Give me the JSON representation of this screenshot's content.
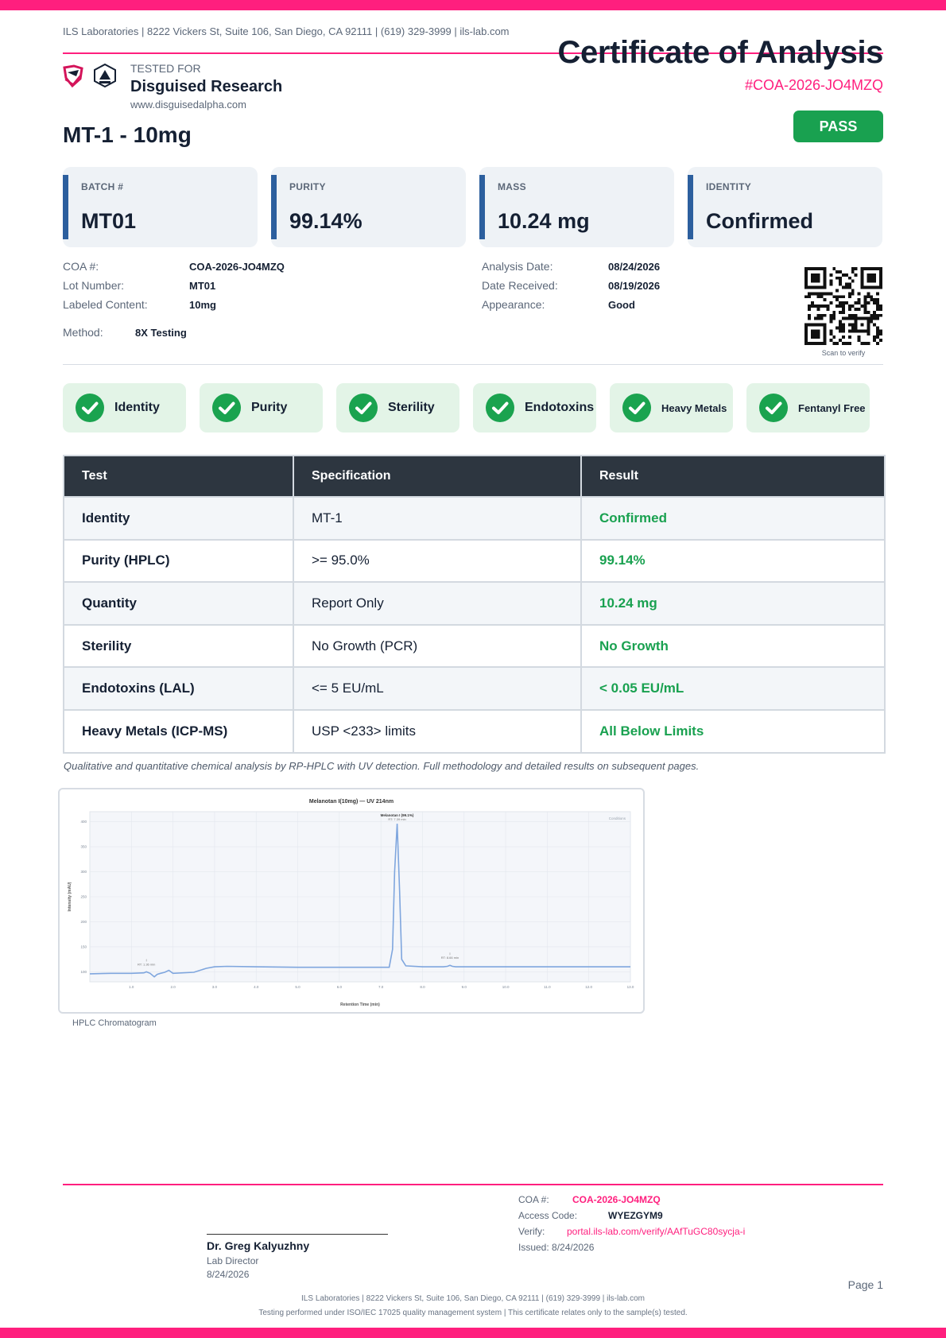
{
  "header": {
    "lab_line": "ILS Laboratories  |  8222 Vickers St, Suite 106, San Diego, CA 92111  |  (619) 329-3999  |  ils-lab.com",
    "title": "Certificate of Analysis",
    "coa_id": "#COA-2026-JO4MZQ",
    "tested_for_label": "TESTED FOR",
    "client_name": "Disguised Research",
    "client_website": "www.disguisedalpha.com",
    "product_name": "MT-1 - 10mg",
    "status": "PASS",
    "brand_color": "#ff1f7e",
    "pass_color": "#19a150"
  },
  "summary_cards": [
    {
      "label": "BATCH #",
      "value": "MT01"
    },
    {
      "label": "PURITY",
      "value": "99.14%"
    },
    {
      "label": "MASS",
      "value": "10.24 mg"
    },
    {
      "label": "IDENTITY",
      "value": "Confirmed"
    }
  ],
  "details": {
    "coa_label": "COA #:",
    "coa_value": "COA-2026-JO4MZQ",
    "lot_label": "Lot Number:",
    "lot_value": "MT01",
    "labeled_label": "Labeled Content:",
    "labeled_value": "10mg",
    "method_label": "Method:",
    "method_value": "8X Testing",
    "analysis_label": "Analysis Date:",
    "analysis_value": "08/24/2026",
    "received_label": "Date Received:",
    "received_value": "08/19/2026",
    "appearance_label": "Appearance:",
    "appearance_value": "Good",
    "qr_caption": "Scan to verify",
    "qr_icon": "qr-code-icon"
  },
  "badges": [
    {
      "label": "Identity",
      "icon": "check-circle-icon"
    },
    {
      "label": "Purity",
      "icon": "check-circle-icon"
    },
    {
      "label": "Sterility",
      "icon": "check-circle-icon"
    },
    {
      "label": "Endotoxins",
      "icon": "check-circle-icon"
    },
    {
      "label": "Heavy Metals",
      "icon": "check-circle-icon"
    },
    {
      "label": "Fentanyl Free",
      "icon": "check-circle-icon"
    }
  ],
  "results_table": {
    "headers": [
      "Test",
      "Specification",
      "Result"
    ],
    "rows": [
      [
        "Identity",
        "MT-1",
        "Confirmed"
      ],
      [
        "Purity (HPLC)",
        ">= 95.0%",
        "99.14%"
      ],
      [
        "Quantity",
        "Report Only",
        "10.24 mg"
      ],
      [
        "Sterility",
        "No Growth (PCR)",
        "No Growth"
      ],
      [
        "Endotoxins (LAL)",
        "<= 5 EU/mL",
        "< 0.05 EU/mL"
      ],
      [
        "Heavy Metals (ICP-MS)",
        "USP <233> limits",
        "All Below Limits"
      ]
    ]
  },
  "analysis_note": "Qualitative and quantitative chemical analysis by RP-HPLC with UV detection. Full methodology and detailed results on subsequent pages.",
  "chromatogram": {
    "caption": "HPLC Chromatogram",
    "chart_data": {
      "type": "line",
      "title": "Melanotan I(10mg) — UV 214nm",
      "xlabel": "Retention Time (min)",
      "ylabel": "Intensity (mAU)",
      "legend": "Conditions",
      "x_ticks": [
        "1.0",
        "2.0",
        "3.0",
        "4.0",
        "5.0",
        "6.0",
        "7.0",
        "8.0",
        "9.0",
        "10.0",
        "11.0",
        "12.0",
        "13.0"
      ],
      "y_ticks": [
        "100",
        "150",
        "200",
        "250",
        "300",
        "350",
        "400"
      ],
      "xlim": [
        0,
        13.0
      ],
      "ylim": [
        80,
        420
      ],
      "main_peak_label": "Melanotan I (99.1%)",
      "main_peak_rt_label": "RT: 7.39 min",
      "minor_peak_1_label": "RT: 1.36 min",
      "minor_peak_2_label": "RT: 8.66 min",
      "series": [
        {
          "x": [
            0,
            0.5,
            1.0,
            1.3,
            1.36,
            1.45,
            1.55,
            1.62,
            1.7,
            1.8,
            1.9,
            2.0,
            2.5,
            2.8,
            3.0,
            3.3,
            4.0,
            5.0,
            6.0,
            7.0,
            7.2,
            7.28,
            7.33,
            7.39,
            7.45,
            7.5,
            7.6,
            8.0,
            8.5,
            8.6,
            8.66,
            8.72,
            8.8,
            9.0,
            10.0,
            11.0,
            12.0,
            13.0
          ],
          "y": [
            96,
            97,
            97,
            98,
            100,
            97,
            90,
            95,
            97,
            99,
            103,
            97,
            99,
            107,
            110,
            111,
            110,
            109,
            109,
            109,
            109,
            145,
            300,
            396,
            260,
            125,
            112,
            110,
            110,
            111,
            113,
            111,
            110,
            110,
            110,
            110,
            110,
            110
          ]
        }
      ]
    }
  },
  "footer": {
    "signatory_name": "Dr. Greg Kalyuzhny",
    "signatory_role": "Lab Director",
    "signatory_date": "8/24/2026",
    "coa_label": "COA #:",
    "coa_value": "COA-2026-JO4MZQ",
    "access_label": "Access Code:",
    "access_value": "WYEZGYM9",
    "verify_label": "Verify:",
    "verify_value": "portal.ils-lab.com/verify/AAfTuGC80sycja-i",
    "issued": "Issued: 8/24/2026",
    "page": "Page 1",
    "lab_line": "ILS Laboratories  |  8222 Vickers St, Suite 106, San Diego, CA 92111  |  (619) 329-3999  |  ils-lab.com",
    "compliance": "Testing performed under ISO/IEC 17025 quality management system  |  This certificate relates only to the sample(s) tested."
  }
}
